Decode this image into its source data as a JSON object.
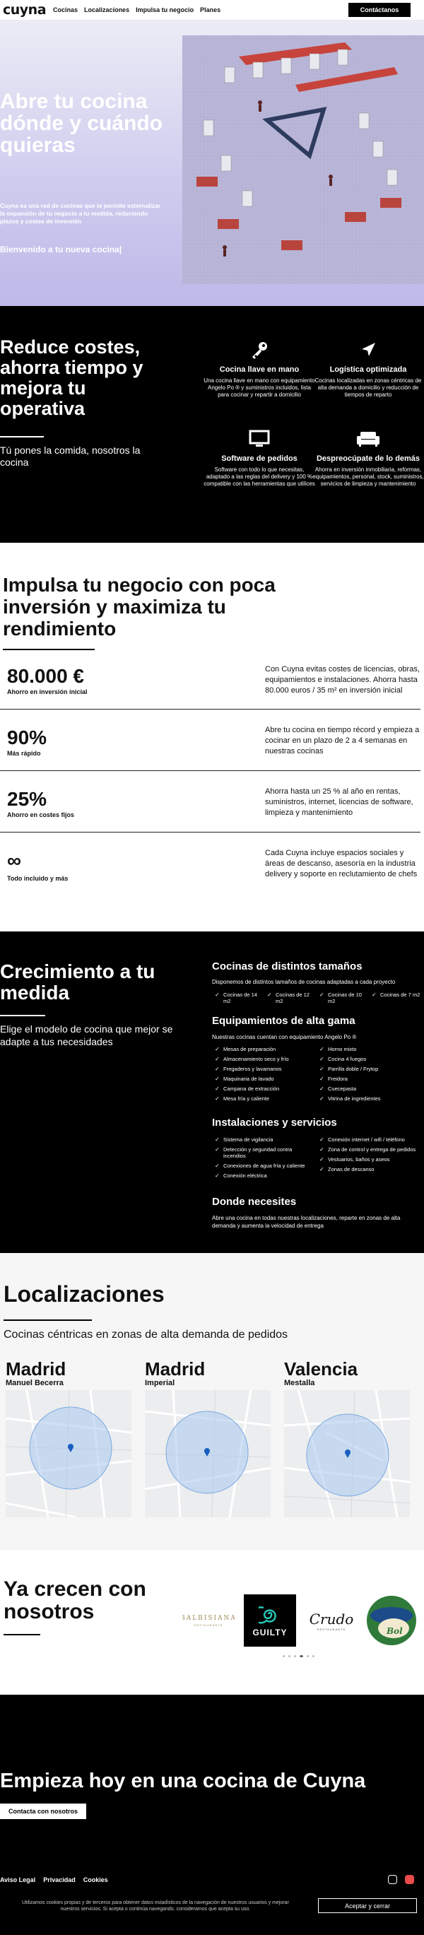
{
  "nav": {
    "logo": "cuyna",
    "links": [
      "Cocinas",
      "Localizaciones",
      "Impulsa tu negocio",
      "Planes"
    ],
    "cta": "Contáctanos"
  },
  "hero": {
    "title": "Abre tu cocina dónde y cuándo quieras",
    "subtitle": "Cuyna es una red de cocinas que te permite externalizar la expansión de tu negocio a tu medida, reduciendo plazos y costes de inversión",
    "welcome": "Bienvenido a tu nueva cocina|"
  },
  "benefits": {
    "title": "Reduce costes, ahorra tiempo y mejora tu operativa",
    "lead": "Tú pones la comida, nosotros la cocina",
    "items": [
      {
        "icon": "key-icon",
        "title": "Cocina llave en mano",
        "text": "Una cocina llave en mano con equipamiento Angelo Po ® y suministros incluidos, lista para cocinar y repartir a domicilio"
      },
      {
        "icon": "navigation-arrow-icon",
        "title": "Logística optimizada",
        "text": "Cocinas localizadas en zonas céntricas de alta demanda a domicilio y reducción de tiempos de reparto"
      },
      {
        "icon": "monitor-icon",
        "title": "Software de pedidos",
        "text": "Software con todo lo que necesitas, adaptado a las reglas del delivery y 100 % compatible con las herramientas que utilices"
      },
      {
        "icon": "sofa-icon",
        "title": "Despreocúpate de lo demás",
        "text": "Ahorra en inversión inmobiliaria, reformas, equipamientos, personal, stock, suministros, servicios de limpieza y mantenimiento"
      }
    ]
  },
  "invest": {
    "title": "Impulsa tu negocio con poca inversión y maximiza tu rendimiento",
    "stats": [
      {
        "value": "80.000 €",
        "label": "Ahorro en inversión inicial",
        "text": "Con Cuyna evitas costes de licencias, obras, equipamientos e instalaciones. Ahorra hasta 80.000 euros / 35 m² en inversión inicial"
      },
      {
        "value": "90%",
        "label": "Más rápido",
        "text": "Abre tu cocina en tiempo récord y empieza a cocinar en un plazo de 2 a 4 semanas en nuestras cocinas"
      },
      {
        "value": "25%",
        "label": "Ahorro en costes fijos",
        "text": "Ahorra hasta un 25 % al año en rentas, suministros, internet, licencias de software, limpieza y mantenimiento"
      },
      {
        "value": "∞",
        "label": "Todo incluido y más",
        "text": "Cada Cuyna incluye espacios sociales y áreas de descanso, asesoría en la industria delivery y soporte en reclutamiento de chefs"
      }
    ]
  },
  "growth": {
    "title": "Crecimiento a tu medida",
    "lead": "Elige el modelo de cocina que mejor se adapte a tus necesidades",
    "sizes": {
      "title": "Cocinas de distintos tamaños",
      "text": "Disponemos de distintos tamaños de cocinas adaptadas a cada proyecto",
      "items": [
        "Cocinas de 14 m2",
        "Cocinas de 12 m2",
        "Cocinas de 10 m2",
        "Cocinas de 7 m2"
      ]
    },
    "equipment": {
      "title": "Equipamientos de alta gama",
      "text": "Nuestras cocinas cuentan con equipamiento Angelo Po ®",
      "col1": [
        "Mesas de preparación",
        "Almacenamiento seco y frío",
        "Fregaderos y lavamanos",
        "Maquinaria de lavado",
        "Campana de extracción",
        "Mesa fría y caliente"
      ],
      "col2": [
        "Horno mixto",
        "Cocina 4 fuegos",
        "Parrilla doble / Frytop",
        "Freidora",
        "Cuecepasta",
        "Vitrina de ingredientes"
      ]
    },
    "facilities": {
      "title": "Instalaciones y servicios",
      "col1": [
        "Sistema de vigilancia",
        "Detección y seguridad contra incendios",
        "Conexiones de agua fría y caliente",
        "Conexión eléctrica"
      ],
      "col2": [
        "Conexión internet / wifi / teléfono",
        "Zona de control y entrega de pedidos",
        "Vestuarios, baños y aseos",
        "Zonas de descanso"
      ]
    },
    "where": {
      "title": "Donde necesites",
      "text": "Abre una cocina en todas nuestras localizaciones, reparte en zonas de alta demanda y aumenta la velocidad de entrega"
    }
  },
  "locations": {
    "title": "Localizaciones",
    "lead": "Cocinas céntricas en zonas de alta demanda de pedidos",
    "items": [
      {
        "city": "Madrid",
        "area": "Manuel Becerra"
      },
      {
        "city": "Madrid",
        "area": "Imperial"
      },
      {
        "city": "Valencia",
        "area": "Mestalla"
      }
    ]
  },
  "clients": {
    "title": "Ya crecen con nosotros",
    "logos": [
      {
        "name": "BALBISIANA",
        "tag": "RESTAURANTE"
      },
      {
        "name": "GUILTY"
      },
      {
        "name": "Crudo",
        "tag": "RESTAURANTE"
      },
      {
        "name": "Bol"
      }
    ]
  },
  "footer": {
    "cta_title": "Empieza hoy en una cocina de Cuyna",
    "cta_button": "Contacta con nosotros",
    "links": [
      "Aviso Legal",
      "Privacidad",
      "Cookies"
    ],
    "cookie_text": "Utilizamos cookies propias y de terceros para obtener datos estadísticos de la navegación de nuestros usuarios y mejorar nuestros servicios. Si acepta o continúa navegando, consideramos que acepta su uso.",
    "cookie_accept": "Aceptar y cerrar"
  }
}
